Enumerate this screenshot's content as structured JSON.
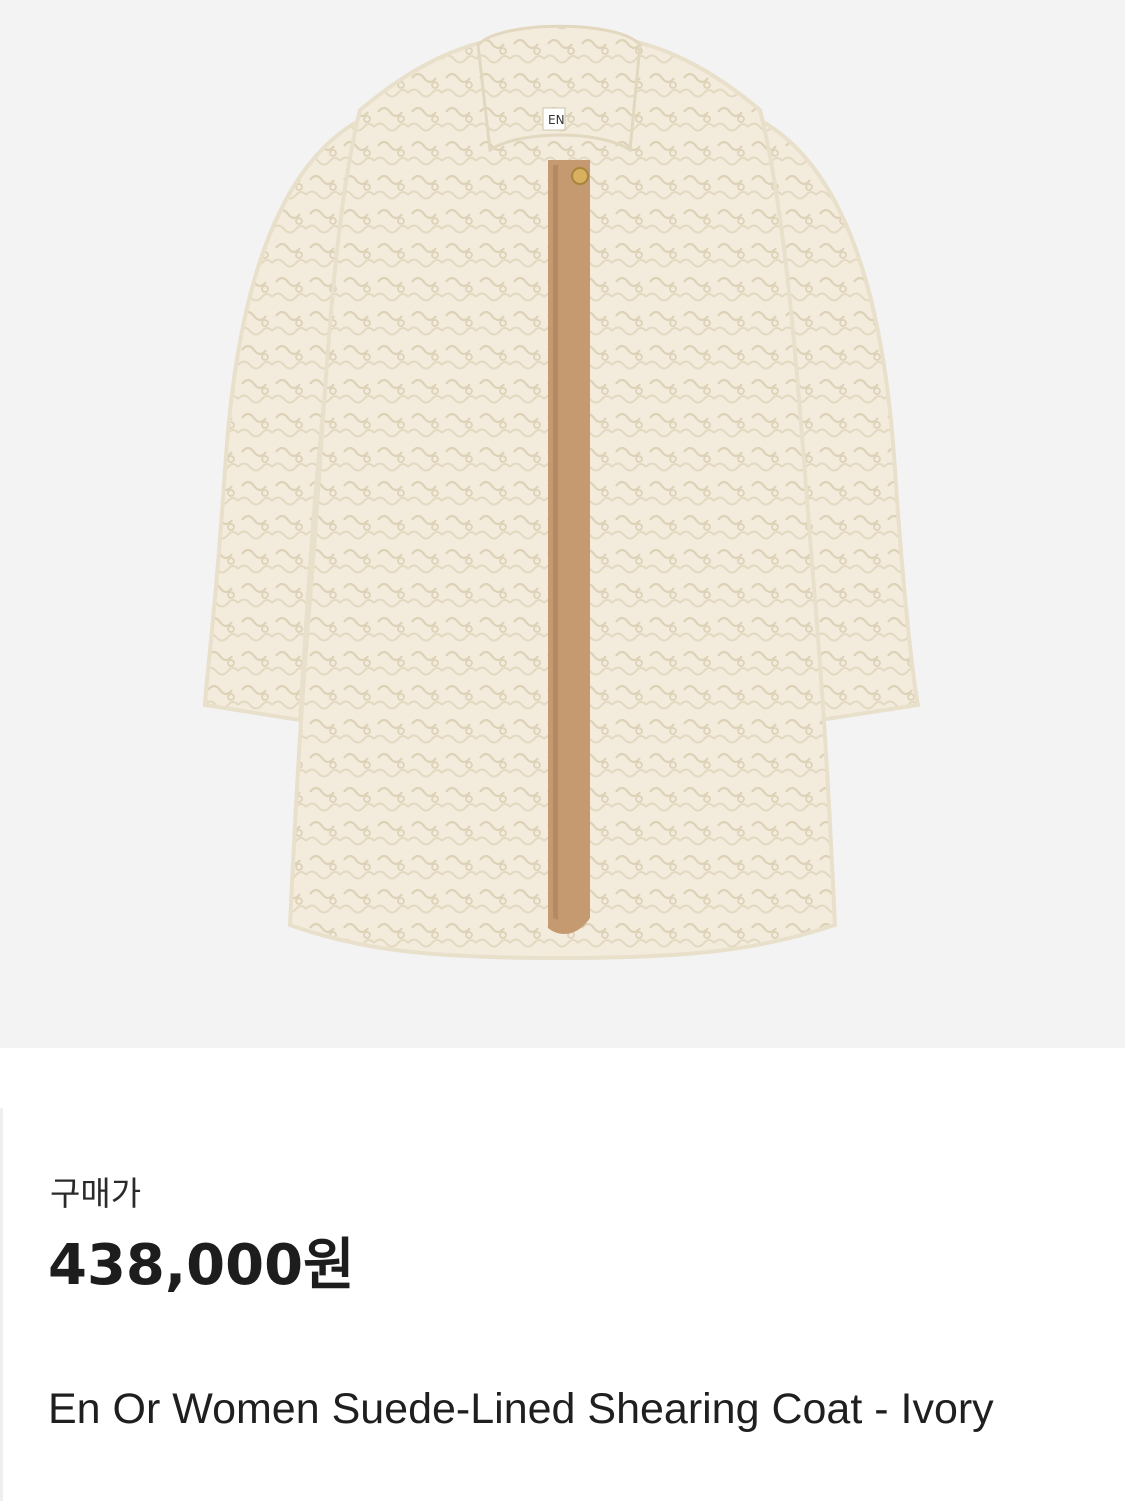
{
  "product_image": {
    "alt": "",
    "background_color": "#f4f3f3",
    "coat_color": "#f3ecdc",
    "placket_color": "#c59a70"
  },
  "price": {
    "label": "구매가",
    "value": "438,000원"
  },
  "product": {
    "name": "En Or Women Suede-Lined Shearing Coat - Ivory"
  }
}
